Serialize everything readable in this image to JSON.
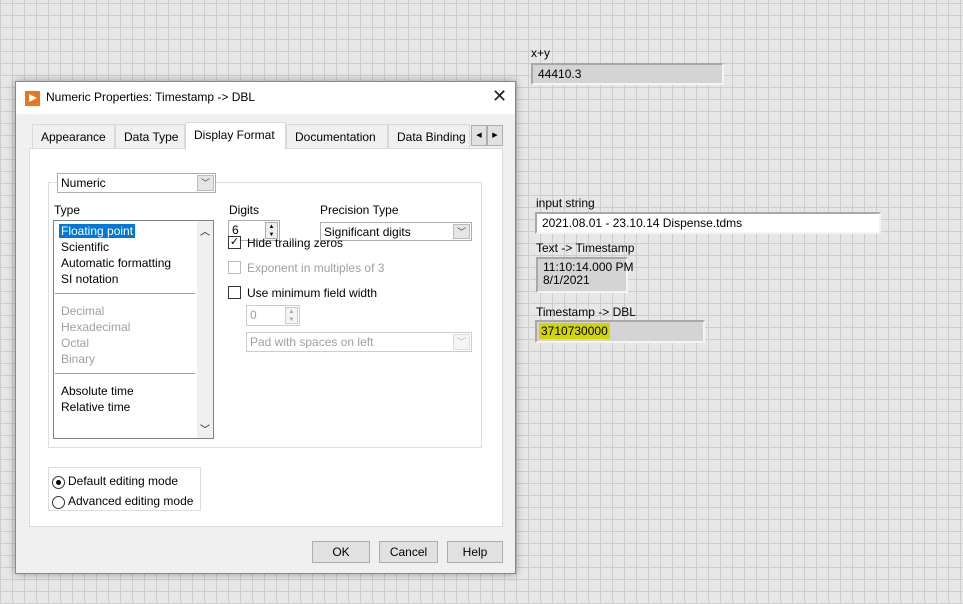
{
  "front_panel": {
    "xy": {
      "label": "x+y",
      "value": "44410.3"
    },
    "input_string": {
      "label": "input string",
      "value": "2021.08.01 - 23.10.14 Dispense.tdms"
    },
    "text_timestamp": {
      "label": "Text -> Timestamp",
      "time": "11:10:14.000 PM",
      "date": "8/1/2021"
    },
    "timestamp_dbl": {
      "label": "Timestamp -> DBL",
      "value": "3710730000",
      "highlight_color": "#d4d400"
    }
  },
  "dialog": {
    "title": "Numeric Properties: Timestamp -> DBL",
    "icon": "labview-arrow-icon",
    "tabs": [
      {
        "label": "Appearance"
      },
      {
        "label": "Data Type"
      },
      {
        "label": "Display Format",
        "active": true
      },
      {
        "label": "Documentation"
      },
      {
        "label": "Data Binding"
      }
    ],
    "format_category": "Numeric",
    "type_label": "Type",
    "types_group1": [
      "Floating point",
      "Scientific",
      "Automatic formatting",
      "SI notation"
    ],
    "types_group2": [
      "Decimal",
      "Hexadecimal",
      "Octal",
      "Binary"
    ],
    "types_group3": [
      "Absolute time",
      "Relative time"
    ],
    "selected_type": "Floating point",
    "digits_label": "Digits",
    "digits_value": "6",
    "precision_label": "Precision Type",
    "precision_value": "Significant digits",
    "hide_trailing_zeros": {
      "label": "Hide trailing zeros",
      "checked": true
    },
    "exponent_multiples": {
      "label": "Exponent in multiples of 3",
      "checked": false,
      "disabled": true
    },
    "min_field_width": {
      "label": "Use minimum field width",
      "checked": false,
      "width_value": "0",
      "pad_value": "Pad with spaces on left"
    },
    "editing_modes": [
      {
        "label": "Default editing mode",
        "selected": true
      },
      {
        "label": "Advanced editing mode",
        "selected": false
      }
    ],
    "buttons": {
      "ok": "OK",
      "cancel": "Cancel",
      "help": "Help"
    },
    "accent_color": "#0078d7"
  }
}
